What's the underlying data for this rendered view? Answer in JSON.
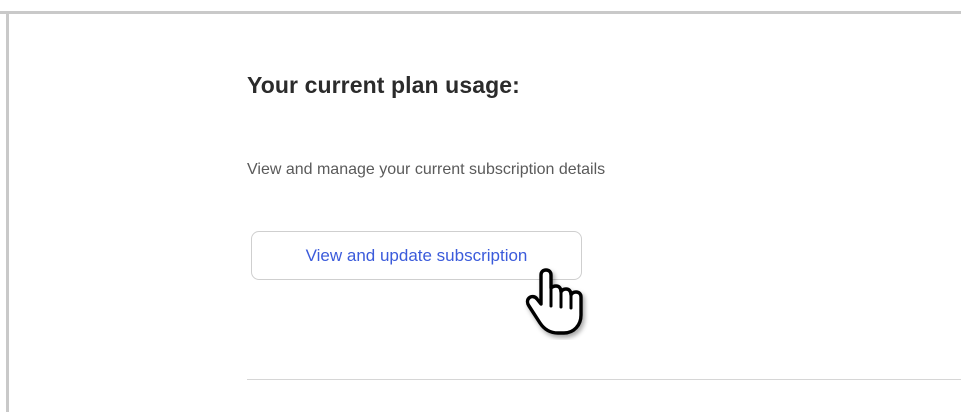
{
  "plan": {
    "heading": "Your current plan usage:",
    "description": "View and manage your current subscription details",
    "button_label": "View and update subscription"
  },
  "cursor": {
    "icon": "hand-pointer-icon"
  },
  "colors": {
    "link": "#3b5bdb",
    "heading": "#2b2b2b",
    "body_text": "#5a5a5a",
    "border": "#c9c9c9"
  }
}
